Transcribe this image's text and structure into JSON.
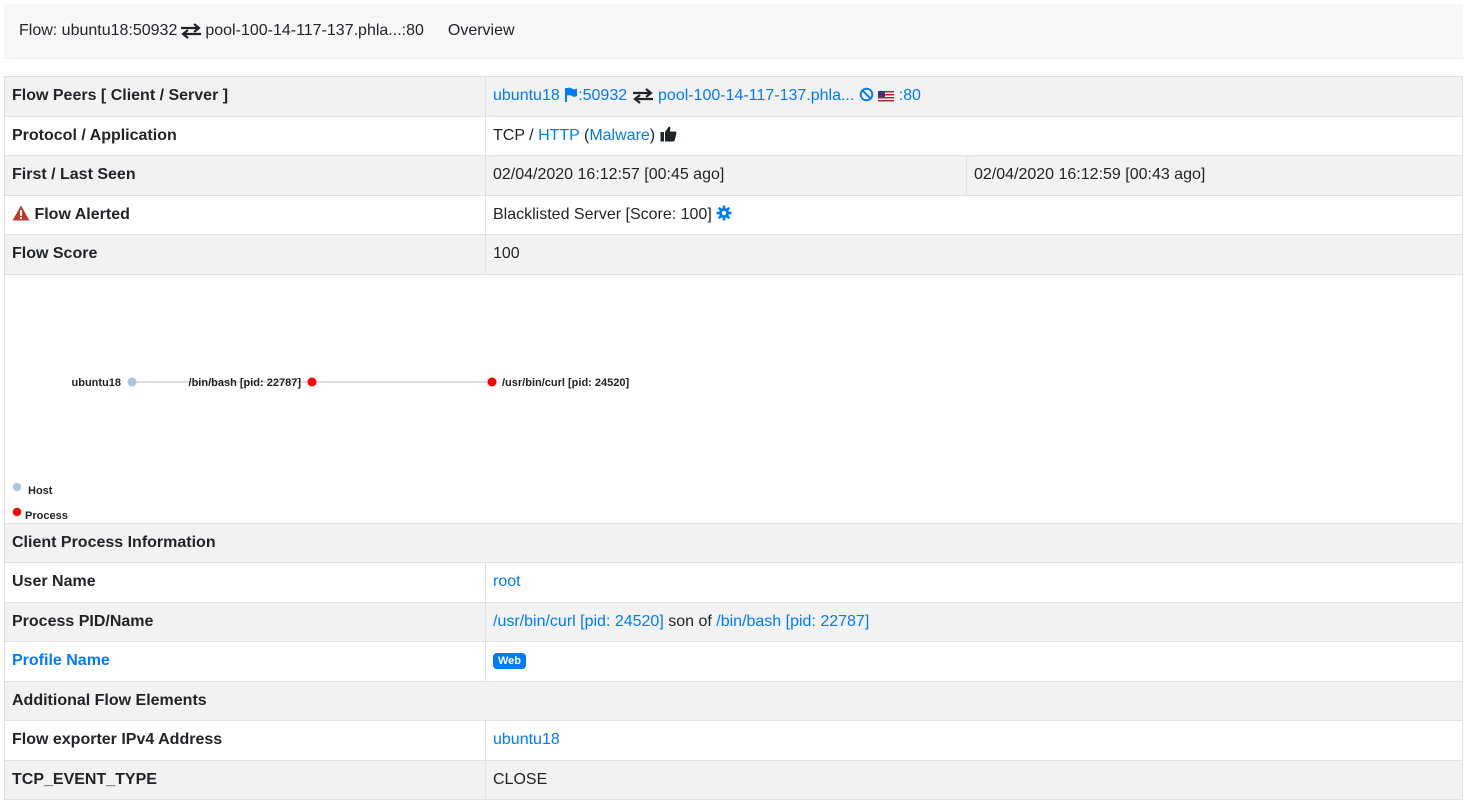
{
  "topbar": {
    "flow_prefix": "Flow: ubuntu18:50932",
    "flow_suffix": "pool-100-14-117-137.phla...:80",
    "overview_label": "Overview"
  },
  "rows": {
    "peers": {
      "label": "Flow Peers [ Client / Server ]",
      "client_host": "ubuntu18",
      "client_port": ":50932",
      "server_host": "pool-100-14-117-137.phla...",
      "server_port": ":80"
    },
    "protocol": {
      "label": "Protocol / Application",
      "l4": "TCP /",
      "app": "HTTP",
      "paren_open": "(",
      "category": "Malware",
      "paren_close": ")"
    },
    "seen": {
      "label": "First / Last Seen",
      "first": "02/04/2020 16:12:57 [00:45 ago]",
      "last": "02/04/2020 16:12:59 [00:43 ago]"
    },
    "alerted": {
      "label": "Flow Alerted",
      "value": "Blacklisted Server [Score: 100]"
    },
    "score": {
      "label": "Flow Score",
      "value": "100"
    },
    "graph": {
      "nodes": [
        {
          "label": "ubuntu18",
          "kind": "host"
        },
        {
          "label": "/bin/bash [pid: 22787]",
          "kind": "process"
        },
        {
          "label": "/usr/bin/curl [pid: 24520]",
          "kind": "process"
        }
      ],
      "legend": [
        {
          "label": "Host",
          "color": "#b0c4de"
        },
        {
          "label": "Process",
          "color": "#ff0000"
        }
      ]
    },
    "client_process_header": "Client Process Information",
    "user": {
      "label": "User Name",
      "value": "root"
    },
    "pid": {
      "label": "Process PID/Name",
      "proc": "/usr/bin/curl [pid: 24520]",
      "son_of": "son of",
      "parent": "/bin/bash [pid: 22787]"
    },
    "profile": {
      "label": "Profile Name",
      "badge": "Web"
    },
    "additional_header": "Additional Flow Elements",
    "exporter": {
      "label": "Flow exporter IPv4 Address",
      "value": "ubuntu18"
    },
    "tcp_event": {
      "label": "TCP_EVENT_TYPE",
      "value": "CLOSE"
    }
  },
  "colors": {
    "link": "#007bff",
    "alert": "#c0392b",
    "host_node": "#b0c4de",
    "process_node": "#ff0000"
  },
  "icons": [
    "exchange-arrows-icon",
    "flag-icon",
    "ban-icon",
    "us-flag-icon",
    "thumbs-up-icon",
    "warning-triangle-icon",
    "cog-icon"
  ]
}
